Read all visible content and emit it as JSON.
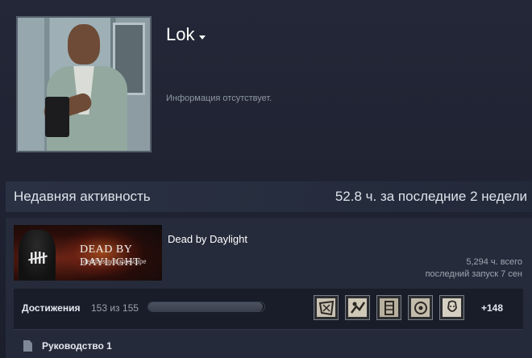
{
  "profile": {
    "persona_name": "Lok",
    "summary": "Информация отсутствует."
  },
  "recent_activity": {
    "title": "Недавняя активность",
    "hours": "52.8",
    "hours_suffix": "ч. за последние",
    "weeks": "2",
    "weeks_suffix": "недели"
  },
  "game": {
    "name": "Dead by Daylight",
    "capsule_title": "DEAD BY DAYLIGHT",
    "capsule_subtitle": "death is not an escape",
    "total_hours": "5,294 ч. всего",
    "last_played": "последний запуск 7 сен",
    "achievements": {
      "label": "Достижения",
      "count": "153 из 155",
      "progress": 0.987,
      "more": "+148",
      "icons": [
        "achievement-icon-1",
        "achievement-icon-2",
        "achievement-icon-3",
        "achievement-icon-4",
        "achievement-icon-5"
      ]
    },
    "guide": {
      "label": "Руководство 1",
      "icon": "document-icon"
    }
  },
  "colors": {
    "background": "#1f2230",
    "header_band": "#2b3244",
    "text_primary": "#ffffff",
    "text_muted": "#9ea6b1"
  }
}
